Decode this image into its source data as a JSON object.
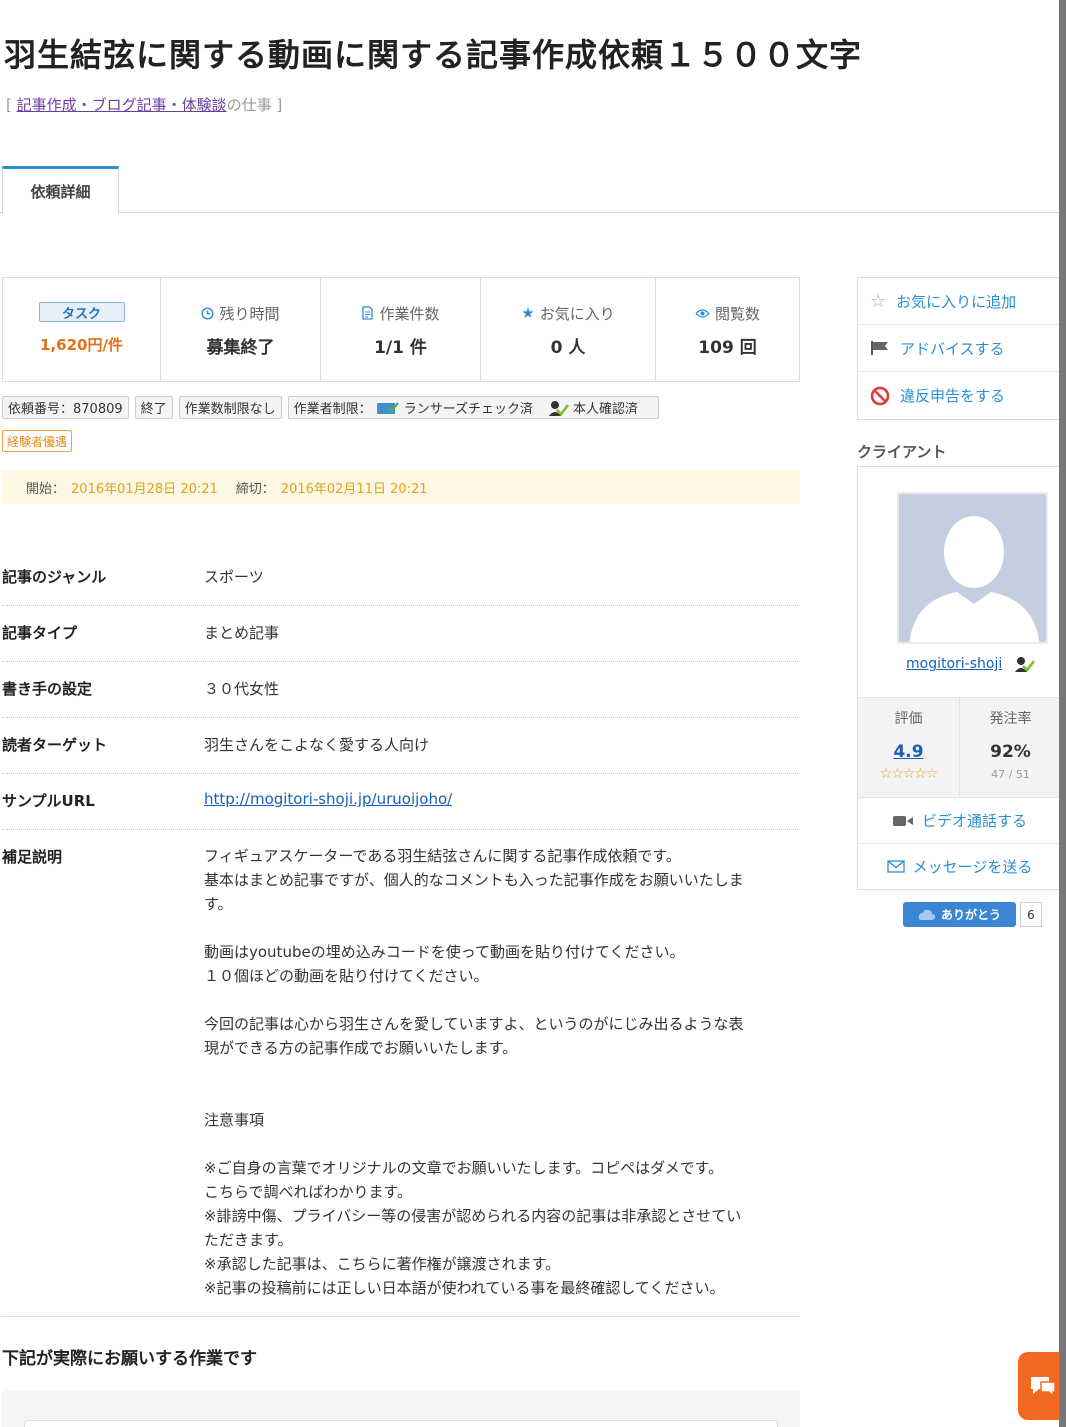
{
  "page": {
    "title": "羽生結弦に関する動画に関する記事作成依頼１５００文字",
    "breadcrumb_open": "[ ",
    "breadcrumb_link": "記事作成・ブログ記事・体験談",
    "breadcrumb_suffix": "の仕事 ]"
  },
  "tabs": [
    {
      "label": "依頼詳細"
    }
  ],
  "stats": {
    "task_badge": "タスク",
    "price": "1,620円/件",
    "remaining_label": "残り時間",
    "remaining_value": "募集終了",
    "work_count_label": "作業件数",
    "work_count_value": "1/1 件",
    "favorites_label": "お気に入り",
    "favorites_value": "0 人",
    "views_label": "閲覧数",
    "views_value": "109 回"
  },
  "tags": {
    "job_number": "依頼番号：870809",
    "status": "終了",
    "limit": "作業数制限なし",
    "worker_limit_label": "作業者制限：",
    "lancers_check": "ランサーズチェック済",
    "identity": "本人確認済",
    "experienced": "経験者優遇"
  },
  "dates": {
    "start_label": "開始：",
    "start_value": "2016年01月28日 20:21",
    "end_label": "締切：",
    "end_value": "2016年02月11日 20:21"
  },
  "details": {
    "genre_label": "記事のジャンル",
    "genre_value": "スポーツ",
    "type_label": "記事タイプ",
    "type_value": "まとめ記事",
    "writer_label": "書き手の設定",
    "writer_value": "３０代女性",
    "target_label": "読者ターゲット",
    "target_value": "羽生さんをこよなく愛する人向け",
    "url_label": "サンプルURL",
    "url_value": "http://mogitori-shoji.jp/uruoijoho/",
    "note_label": "補足説明",
    "note_lines": [
      "フィギュアスケーターである羽生結弦さんに関する記事作成依頼です。",
      "基本はまとめ記事ですが、個人的なコメントも入った記事作成をお願いいたしま",
      "す。",
      "動画はyoutubeの埋め込みコードを使って動画を貼り付けてください。",
      "１０個ほどの動画を貼り付けてください。",
      "今回の記事は心から羽生さんを愛していますよ、というのがにじみ出るような表",
      "現ができる方の記事作成でお願いいたします。",
      "注意事項",
      "※ご自身の言葉でオリジナルの文章でお願いいたします。コピペはダメです。",
      "こちらで調べればわかります。",
      "※誹謗中傷、プライバシー等の侵害が認められる内容の記事は非承認とさせてい",
      "ただきます。",
      "※承認した記事は、こちらに著作権が譲渡されます。",
      "※記事の投稿前には正しい日本語が使われている事を最終確認してください。"
    ]
  },
  "bottom_heading": "下記が実際にお願いする作業です",
  "sidebar": {
    "add_favorite": "お気に入りに追加",
    "advice": "アドバイスする",
    "report": "違反申告をする",
    "client_heading": "クライアント",
    "client_name": "mogitori-shoji",
    "rating_label": "評価",
    "rating_value": "4.9",
    "order_rate_label": "発注率",
    "order_rate_value": "92%",
    "order_rate_sub": "47 / 51",
    "video_call": "ビデオ通話する",
    "message": "メッセージを送る",
    "thanks_label": "ありがとう",
    "thanks_count": "6"
  },
  "colors": {
    "accent": "#2a8fd6",
    "price": "#e0711a",
    "date_highlight": "#e0a21a",
    "fab": "#f26a21"
  }
}
